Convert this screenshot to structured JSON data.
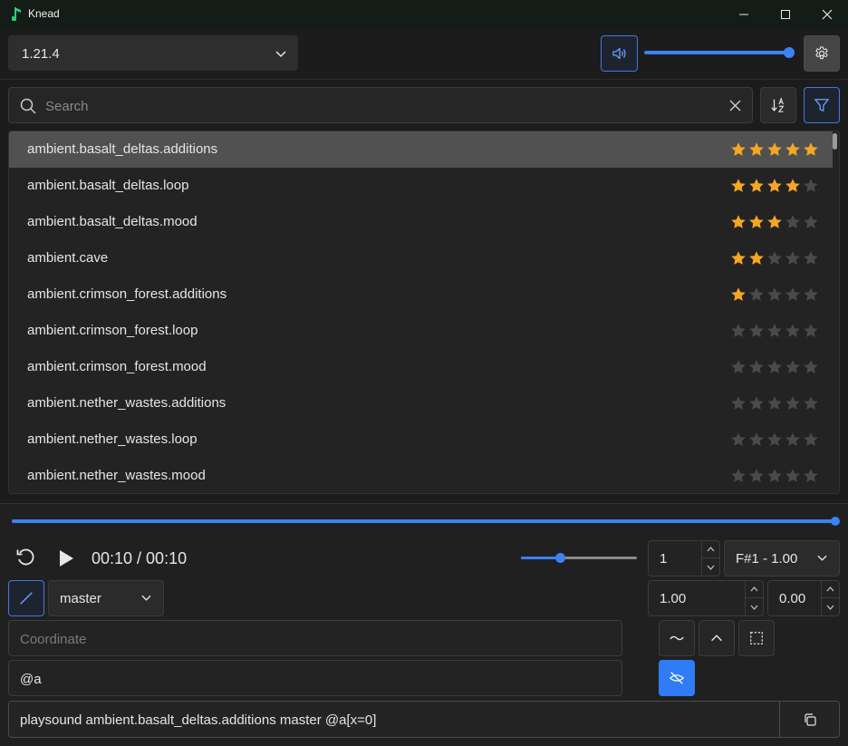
{
  "window": {
    "title": "Knead"
  },
  "version_select": {
    "value": "1.21.4"
  },
  "volume": {
    "level": 1.0
  },
  "search": {
    "placeholder": "Search",
    "value": ""
  },
  "sounds": [
    {
      "name": "ambient.basalt_deltas.additions",
      "rating": 5,
      "selected": true
    },
    {
      "name": "ambient.basalt_deltas.loop",
      "rating": 4,
      "selected": false
    },
    {
      "name": "ambient.basalt_deltas.mood",
      "rating": 3,
      "selected": false
    },
    {
      "name": "ambient.cave",
      "rating": 2,
      "selected": false
    },
    {
      "name": "ambient.crimson_forest.additions",
      "rating": 1,
      "selected": false
    },
    {
      "name": "ambient.crimson_forest.loop",
      "rating": 0,
      "selected": false
    },
    {
      "name": "ambient.crimson_forest.mood",
      "rating": 0,
      "selected": false
    },
    {
      "name": "ambient.nether_wastes.additions",
      "rating": 0,
      "selected": false
    },
    {
      "name": "ambient.nether_wastes.loop",
      "rating": 0,
      "selected": false
    },
    {
      "name": "ambient.nether_wastes.mood",
      "rating": 0,
      "selected": false
    }
  ],
  "player": {
    "time": "00:10 / 00:10",
    "progress": 1.0,
    "speed": 0.33
  },
  "count_field": {
    "value": "1"
  },
  "pitch_select": {
    "value": "F#1 - 1.00"
  },
  "category_select": {
    "value": "master"
  },
  "volume_field": {
    "value": "1.00"
  },
  "min_volume_field": {
    "value": "0.00"
  },
  "coordinate_field": {
    "placeholder": "Coordinate",
    "value": ""
  },
  "target_field": {
    "value": "@a"
  },
  "command": {
    "text": "playsound ambient.basalt_deltas.additions master @a[x=0]"
  },
  "colors": {
    "accent": "#3b82f6",
    "star_active": "#f5a623",
    "star_inactive": "#4a4a4a",
    "app_icon": "#2ecc71"
  },
  "icons": [
    "app-icon",
    "minimize-icon",
    "maximize-icon",
    "close-icon",
    "chevron-down-icon",
    "speaker-icon",
    "gear-icon",
    "search-icon",
    "clear-icon",
    "sort-az-icon",
    "filter-icon",
    "star-icon",
    "replay-icon",
    "play-icon",
    "chevron-up-icon",
    "slash-icon",
    "wave-icon",
    "caret-up-icon",
    "dashed-square-icon",
    "hide-icon",
    "copy-icon"
  ]
}
